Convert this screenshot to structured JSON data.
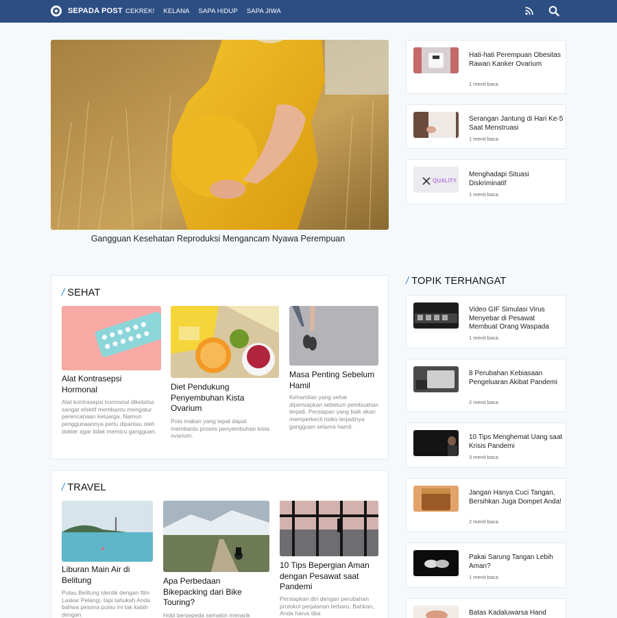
{
  "nav": {
    "brand": "SEPADA POST",
    "items": [
      "CEKREK!",
      "KELANA",
      "SAPA HIDUP",
      "SAPA JIWA"
    ]
  },
  "hero": {
    "caption": "Gangguan Kesehatan Reproduksi Mengancam Nyawa Perempuan"
  },
  "side_top": [
    {
      "title": "Hati-hati Perempuan Obesitas Rawan Kanker Ovarium",
      "meta": "1 menit baca"
    },
    {
      "title": "Serangan Jantung di Hari Ke-5 Saat Menstruasi",
      "meta": "1 menit baca"
    },
    {
      "title": "Menghadapi Situasi Diskriminatif",
      "meta": "1 menit baca",
      "thumb_text": "QUALITY"
    }
  ],
  "sehat": {
    "heading": "SEHAT",
    "cards": [
      {
        "title": "Alat Kontrasepsi Hormonal",
        "desc": "Alat kontrasepsi hormonal diketahui sangat efektif membantu mengatur perencanaan keluarga. Namun penggunaannya perlu dipantau oleh dokter agar tidak memicu gangguan."
      },
      {
        "title": "Diet Pendukung Penyembuhan Kista Ovarium",
        "desc": "Pola makan yang tepat dapat membantu proses penyembuhan kista ovarium."
      },
      {
        "title": "Masa Penting Sebelum Hamil",
        "desc": "Kehamilan yang sehat dipersiapkan sebelum pembuahan terjadi. Persiapan yang baik akan memperkecil risiko terjadinya gangguan selama hamil."
      }
    ]
  },
  "travel": {
    "heading": "TRAVEL",
    "cards": [
      {
        "title": "Liburan Main Air di Belitung",
        "desc": "Pulau Belitung identik dengan film Laskar Pelangi, tapi tahukah Anda bahwa pesona pulau ini tak kalah dengan"
      },
      {
        "title": "Apa Perbedaan Bikepacking dari Bike Touring?",
        "desc": "Hobi bersepeda semakin menarik"
      },
      {
        "title": "10 Tips Bepergian Aman dengan Pesawat saat Pandemi",
        "desc": "Persiapkan diri dengan perubahan protokol perjalanan terbaru. Bahkan, Anda harus tiba"
      }
    ]
  },
  "topik": {
    "heading": "TOPIK TERHANGAT",
    "items": [
      {
        "title": "Video GIF Simulasi Virus Menyebar di Pesawat Membuat Orang Waspada",
        "meta": "1 menit baca"
      },
      {
        "title": "8 Perubahan Kebiasaan Pengeluaran Akibat Pandemi",
        "meta": "2 menit baca"
      },
      {
        "title": "10 Tips Menghemat Uang saat Krisis Pandemi",
        "meta": "3 menit baca"
      },
      {
        "title": "Jangan Hanya Cuci Tangan, Bersihkan Juga Dompet Anda!",
        "meta": "2 menit baca"
      },
      {
        "title": "Pakai Sarung Tangan Lebih Aman?",
        "meta": "1 menit baca"
      },
      {
        "title": "Batas Kadaluwarsa Hand",
        "meta": ""
      }
    ]
  },
  "colors": {
    "nav": "#2d4e83",
    "accent": "#2e8ad8",
    "bg": "#f6f9fc"
  }
}
